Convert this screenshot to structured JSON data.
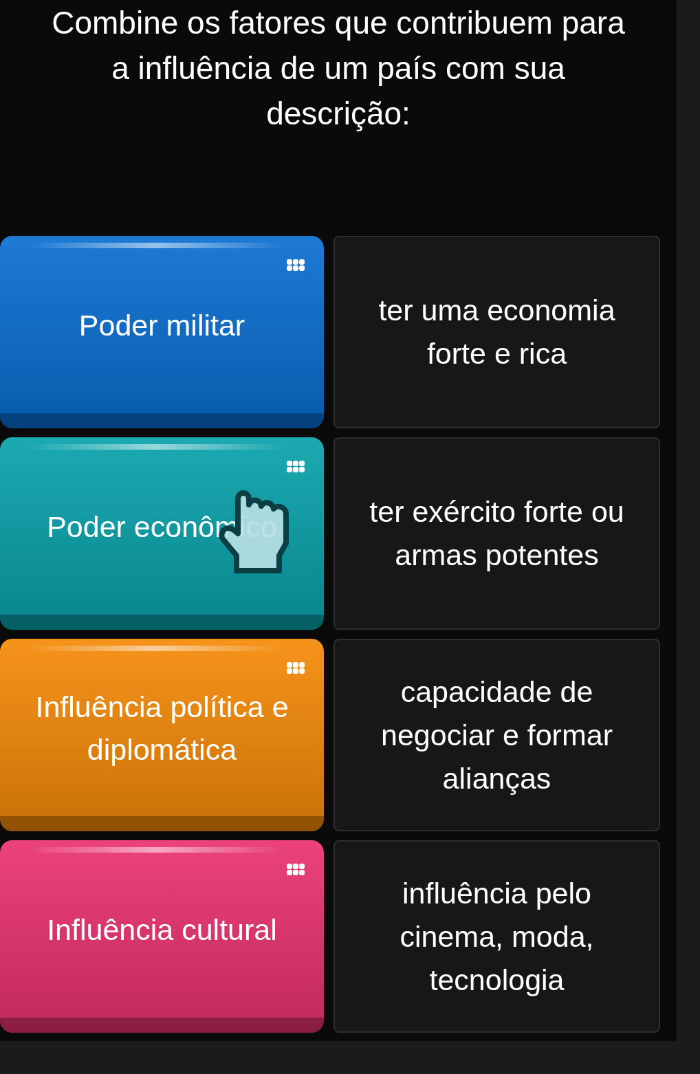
{
  "title": "Combine os fatores que contribuem para a influência de um país com sua descrição:",
  "pairs": [
    {
      "factor": {
        "label": "Poder militar",
        "color": "#0a6fd2",
        "hovered": false
      },
      "description": "ter uma economia forte e rica"
    },
    {
      "factor": {
        "label": "Poder econômico",
        "color": "#09a2ab",
        "hovered": true
      },
      "description": "ter exército forte ou armas potentes"
    },
    {
      "factor": {
        "label": "Influência política e diplomática",
        "color": "#f58a08",
        "hovered": false
      },
      "description": "capacidade de negociar e formar alianças"
    },
    {
      "factor": {
        "label": "Influência cultural",
        "color": "#ea3270",
        "hovered": false
      },
      "description": "influência pelo cinema, moda, tecnologia"
    }
  ]
}
